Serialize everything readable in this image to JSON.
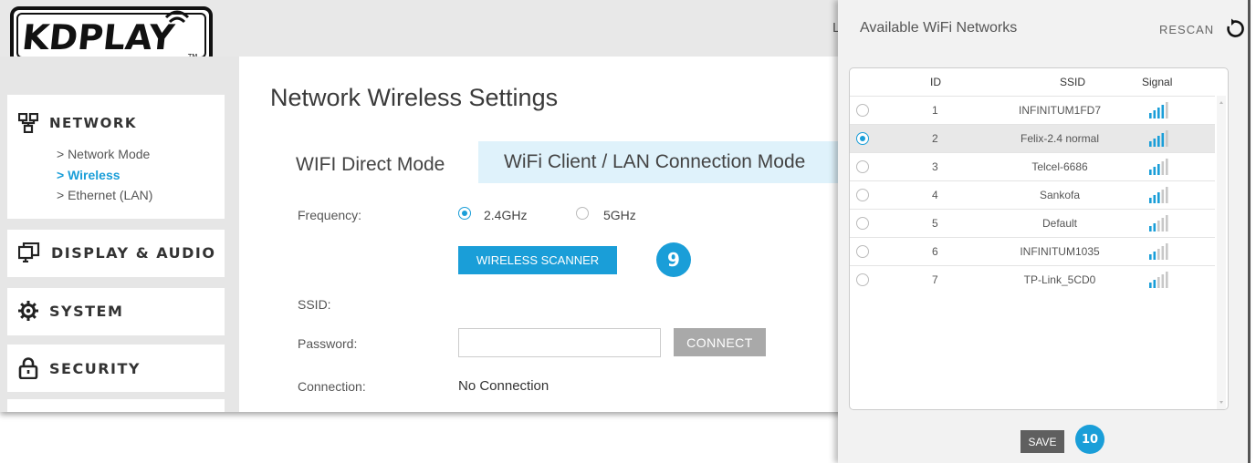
{
  "header": {
    "corner_letter": "L",
    "logo_text": "KDPLAY",
    "logo_tm": "TM"
  },
  "sidebar": {
    "network": {
      "label": "NETWORK",
      "items": [
        {
          "label": "> Network Mode"
        },
        {
          "label": "> Wireless"
        },
        {
          "label": "> Ethernet (LAN)"
        }
      ]
    },
    "display_audio": {
      "label": "DISPLAY & AUDIO"
    },
    "system": {
      "label": "SYSTEM"
    },
    "security": {
      "label": "SECURITY"
    }
  },
  "main": {
    "title": "Network Wireless Settings",
    "tabs": [
      {
        "label": "WIFI Direct Mode"
      },
      {
        "label": "WiFi Client / LAN Connection Mode"
      }
    ],
    "frequency": {
      "label": "Frequency:",
      "options": [
        "2.4GHz",
        "5GHz"
      ],
      "selected": "2.4GHz"
    },
    "scanner_button": "WIRELESS SCANNER",
    "step_badge": "9",
    "ssid_label": "SSID:",
    "password_label": "Password:",
    "password_value": "",
    "connect_button": "CONNECT",
    "connection_label": "Connection:",
    "connection_value": "No Connection"
  },
  "wifi_panel": {
    "title": "Available WiFi Networks",
    "rescan_label": "RESCAN",
    "columns": {
      "id": "ID",
      "ssid": "SSID",
      "signal": "Signal"
    },
    "networks": [
      {
        "id": "1",
        "ssid": "INFINITUM1FD7",
        "selected": false,
        "bars": 4
      },
      {
        "id": "2",
        "ssid": "Felix-2.4 normal",
        "selected": true,
        "bars": 4
      },
      {
        "id": "3",
        "ssid": "Telcel-6686",
        "selected": false,
        "bars": 3
      },
      {
        "id": "4",
        "ssid": "Sankofa",
        "selected": false,
        "bars": 3
      },
      {
        "id": "5",
        "ssid": "Default",
        "selected": false,
        "bars": 2
      },
      {
        "id": "6",
        "ssid": "INFINITUM1035",
        "selected": false,
        "bars": 2
      },
      {
        "id": "7",
        "ssid": "TP-Link_5CD0",
        "selected": false,
        "bars": 2
      }
    ],
    "save_button": "SAVE",
    "step_badge": "10"
  },
  "colors": {
    "accent": "#1a9ed8",
    "tab_inactive_bg": "#dff2fb",
    "sidebar_bg": "#e6e6e6",
    "save_button_bg": "#5f5f5f",
    "connect_button_bg": "#a9a9a9",
    "signal_on": "#1a9ed8",
    "signal_off": "#c8c8c8"
  }
}
